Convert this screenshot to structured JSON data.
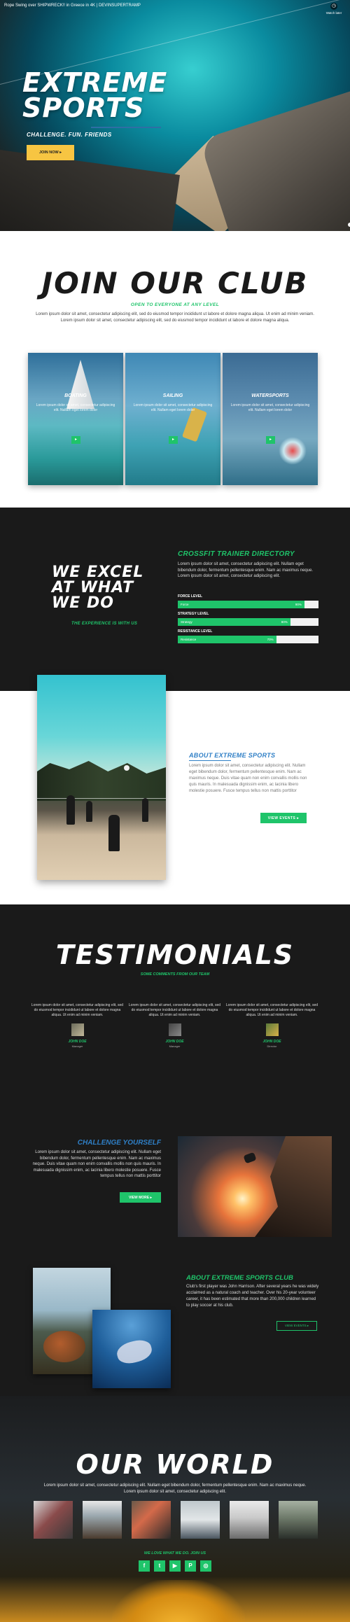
{
  "hero": {
    "video_title": "Rope Swing over SHIPWRECK!! in Greece in 4K | DEVINSUPERTRAMP",
    "watch_later": "Watch later",
    "title_line1": "EXTREME",
    "title_line2": "SPORTS",
    "tagline": "CHALLENGE. FUN. FRIENDS",
    "join_button": "JOIN NOW ▸"
  },
  "join": {
    "title": "JOIN OUR CLUB",
    "subtitle": "OPEN TO EVERYONE AT ANY LEVEL",
    "paragraph": "Lorem ipsum dolor sit amet, consectetur adipiscing elit, sed do eiusmod tempor incididunt ut labore et dolore magna aliqua. Ut enim ad minim veniam. Lorem ipsum dolor sit amet, consectetur adipiscing elit, sed do eiusmod tempor incididunt ut labore et dolore magna aliqua.",
    "cards": [
      {
        "title": "BOATING",
        "text": "Lorem ipsum dolor sit amet, consectetur adipiscing elit. Nullam eget lorem dolor",
        "button": "▸"
      },
      {
        "title": "SAILING",
        "text": "Lorem ipsum dolor sit amet, consectetur adipiscing elit. Nullam eget lorem dolor",
        "button": "▸"
      },
      {
        "title": "WATERSPORTS",
        "text": "Lorem ipsum dolor sit amet, consectetur adipiscing elit. Nullam eget lorem dolor",
        "button": "▸"
      }
    ]
  },
  "excel": {
    "title_line1": "WE EXCEL",
    "title_line2": "AT WHAT",
    "title_line3": "WE DO",
    "subtitle": "THE EXPERIENCE IS WITH US",
    "directory_title": "CROSSFIT TRAINER DIRECTORY",
    "directory_text": "Lorem ipsum dolor sit amet, consectetur adipiscing elit. Nullam eget bibendum dolor, fermentum pellentesque enim. Nam ac maximus neque. Lorem ipsum dolor sit amet, consectetur adipiscing elit.",
    "bars": [
      {
        "label": "FORCE LEVEL",
        "name": "Force",
        "percent": 90,
        "percent_label": "90%"
      },
      {
        "label": "STRATEGY LEVEL",
        "name": "Strategy",
        "percent": 80,
        "percent_label": "80%"
      },
      {
        "label": "RESISTANCE LEVEL",
        "name": "Resistance",
        "percent": 70,
        "percent_label": "70%"
      }
    ]
  },
  "about": {
    "title": "ABOUT EXTREME SPORTS",
    "text": "Lorem ipsum dolor sit amet, consectetur adipiscing elit. Nullam eget bibendum dolor, fermentum pellentesque enim. Nam ac maximus neque. Duis vitae quam non enim convallis mollis non quis mauris. In malesuada dignissim enim, ac lacinia libero molestie posuere. Fusce tempus tellus non mattis porttitor",
    "button": "VIEW EVENTS ▸"
  },
  "testimonials": {
    "title": "TESTIMONIALS",
    "subtitle": "SOME COMMENTS FROM OUR TEAM",
    "items": [
      {
        "quote": "Lorem ipsum dolor sit amet, consectetur adipiscing elit, sed do eiusmod tempor incididunt ut labore et dolore magna aliqua. Ut enim ad minim veniam.",
        "name": "JOHN DOE",
        "role": "Manager"
      },
      {
        "quote": "Lorem ipsum dolor sit amet, consectetur adipiscing elit, sed do eiusmod tempor incididunt ut labore et dolore magna aliqua. Ut enim ad minim veniam.",
        "name": "JOHN DOE",
        "role": "Manager"
      },
      {
        "quote": "Lorem ipsum dolor sit amet, consectetur adipiscing elit, sed do eiusmod tempor incididunt ut labore et dolore magna aliqua. Ut enim ad minim veniam.",
        "name": "JOHN DOE",
        "role": "Director"
      }
    ]
  },
  "challenge": {
    "title": "CHALLENGE YOURSELF",
    "text": "Lorem ipsum dolor sit amet, consectetur adipiscing elit. Nullam eget bibendum dolor, fermentum pellentesque enim. Nam ac maximus neque. Duis vitae quam non enim convallis mollis non quis mauris. In malesuada dignissim enim, ac lacinia libero molestie posuere. Fusce tempus tellus non mattis porttitor",
    "button": "VIEW MORE ▸"
  },
  "club": {
    "title": "ABOUT EXTREME SPORTS CLUB",
    "text": "Club's first player was John Harrison. After several years he was widely acclaimed as a natural coach and teacher. Over his 20-year volunteer career, it has been estimated that more than 200,000 children learned to play soccer at his club.",
    "button": "VIEW EVENTS ▸"
  },
  "world": {
    "title": "OUR WORLD",
    "paragraph": "Lorem ipsum dolor sit amet, consectetur adipiscing elit. Nullam eget bibendum dolor, fermentum pellentesque enim. Nam ac maximus neque. Lorem ipsum dolor sit amet, consectetur adipiscing elit.",
    "love": "WE LOVE WHAT WE DO. JOIN US",
    "socials": [
      {
        "icon": "facebook-icon",
        "glyph": "f"
      },
      {
        "icon": "twitter-icon",
        "glyph": "t"
      },
      {
        "icon": "youtube-icon",
        "glyph": "▶"
      },
      {
        "icon": "pinterest-icon",
        "glyph": "P"
      },
      {
        "icon": "instagram-icon",
        "glyph": "◎"
      }
    ]
  },
  "colors": {
    "accent_green": "#1fc46a",
    "accent_blue": "#2f7fc6",
    "hero_button": "#f7c542",
    "dark_bg": "#1a1a1a"
  }
}
